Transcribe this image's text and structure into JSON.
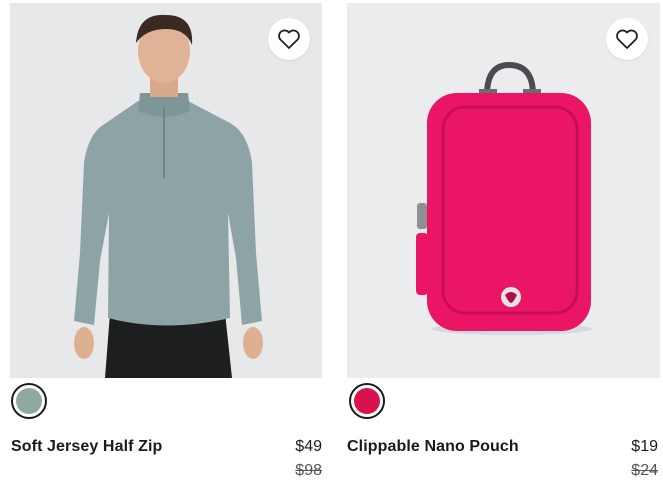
{
  "products": [
    {
      "name": "Soft Jersey Half Zip",
      "price": "$49",
      "original_price": "$98",
      "favorite_icon": "heart-outline-icon",
      "swatch_color": "#8fa9a0",
      "image_subject": "man wearing sage half-zip"
    },
    {
      "name": "Clippable Nano Pouch",
      "price": "$19",
      "original_price": "$24",
      "favorite_icon": "heart-outline-icon",
      "swatch_color": "#d9124e",
      "image_subject": "pink nano pouch with clip"
    }
  ],
  "colors": {
    "shirt": "#8ea3a6",
    "pouch": "#ec1766",
    "price_text": "#1a1a1a",
    "strike_text": "#555555"
  }
}
